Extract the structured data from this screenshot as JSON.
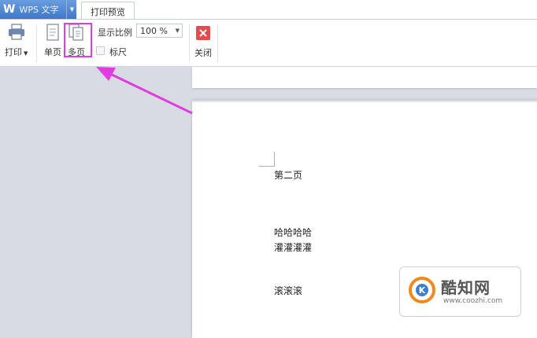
{
  "app": {
    "logo": "W",
    "name": "WPS 文字"
  },
  "tabs": [
    {
      "label": "打印预览",
      "active": true
    }
  ],
  "toolbar": {
    "print_label": "打印",
    "single_page_label": "单页",
    "multi_page_label": "多页",
    "zoom_label": "显示比例",
    "zoom_value": "100 %",
    "ruler_label": "标尺",
    "ruler_checked": false,
    "close_label": "关闭"
  },
  "document": {
    "lines": [
      "第二页",
      "哈哈哈哈",
      "灌灌灌灌",
      "滚滚滚"
    ]
  },
  "watermark": {
    "name": "酷知网",
    "url": "www.coozhi.com"
  },
  "colors": {
    "annotation": "#e23ce0",
    "close_red": "#e34c4c",
    "app_blue": "#4a82cf"
  }
}
